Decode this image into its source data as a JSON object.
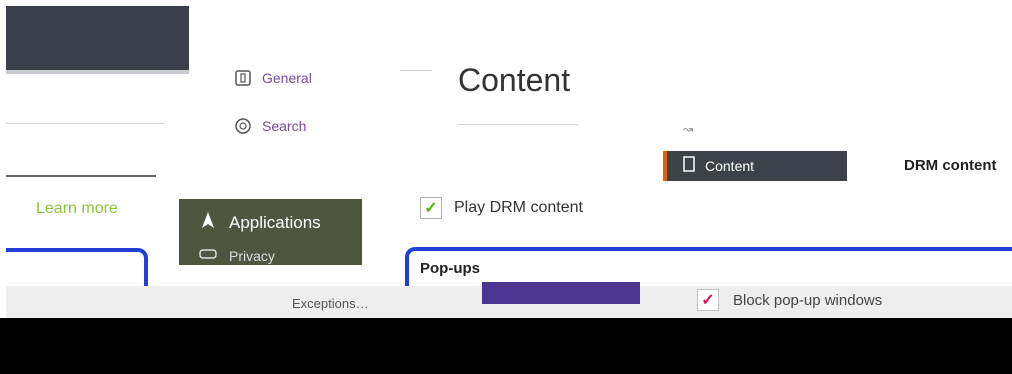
{
  "sidebar": {
    "items": [
      {
        "label": "General",
        "icon": "general-icon"
      },
      {
        "label": "Search",
        "icon": "search-icon"
      },
      {
        "label": "Content",
        "icon": "content-icon"
      },
      {
        "label": "Applications",
        "icon": "applications-icon"
      },
      {
        "label": "Privacy",
        "icon": "privacy-icon"
      }
    ],
    "learn_more": "Learn more"
  },
  "main": {
    "title": "Content",
    "drm_section_heading": "DRM content",
    "drm_checkbox_label": "Play DRM content",
    "drm_checked": true,
    "popups_heading": "Pop-ups",
    "exceptions_button": "Exceptions…",
    "block_popups_label": "Block pop-up windows",
    "block_popups_checked": true
  },
  "colors": {
    "accent_orange": "#e66000",
    "link_green": "#8cc63f",
    "check_green": "#57b700",
    "highlight_blue": "#1f3fd6"
  }
}
